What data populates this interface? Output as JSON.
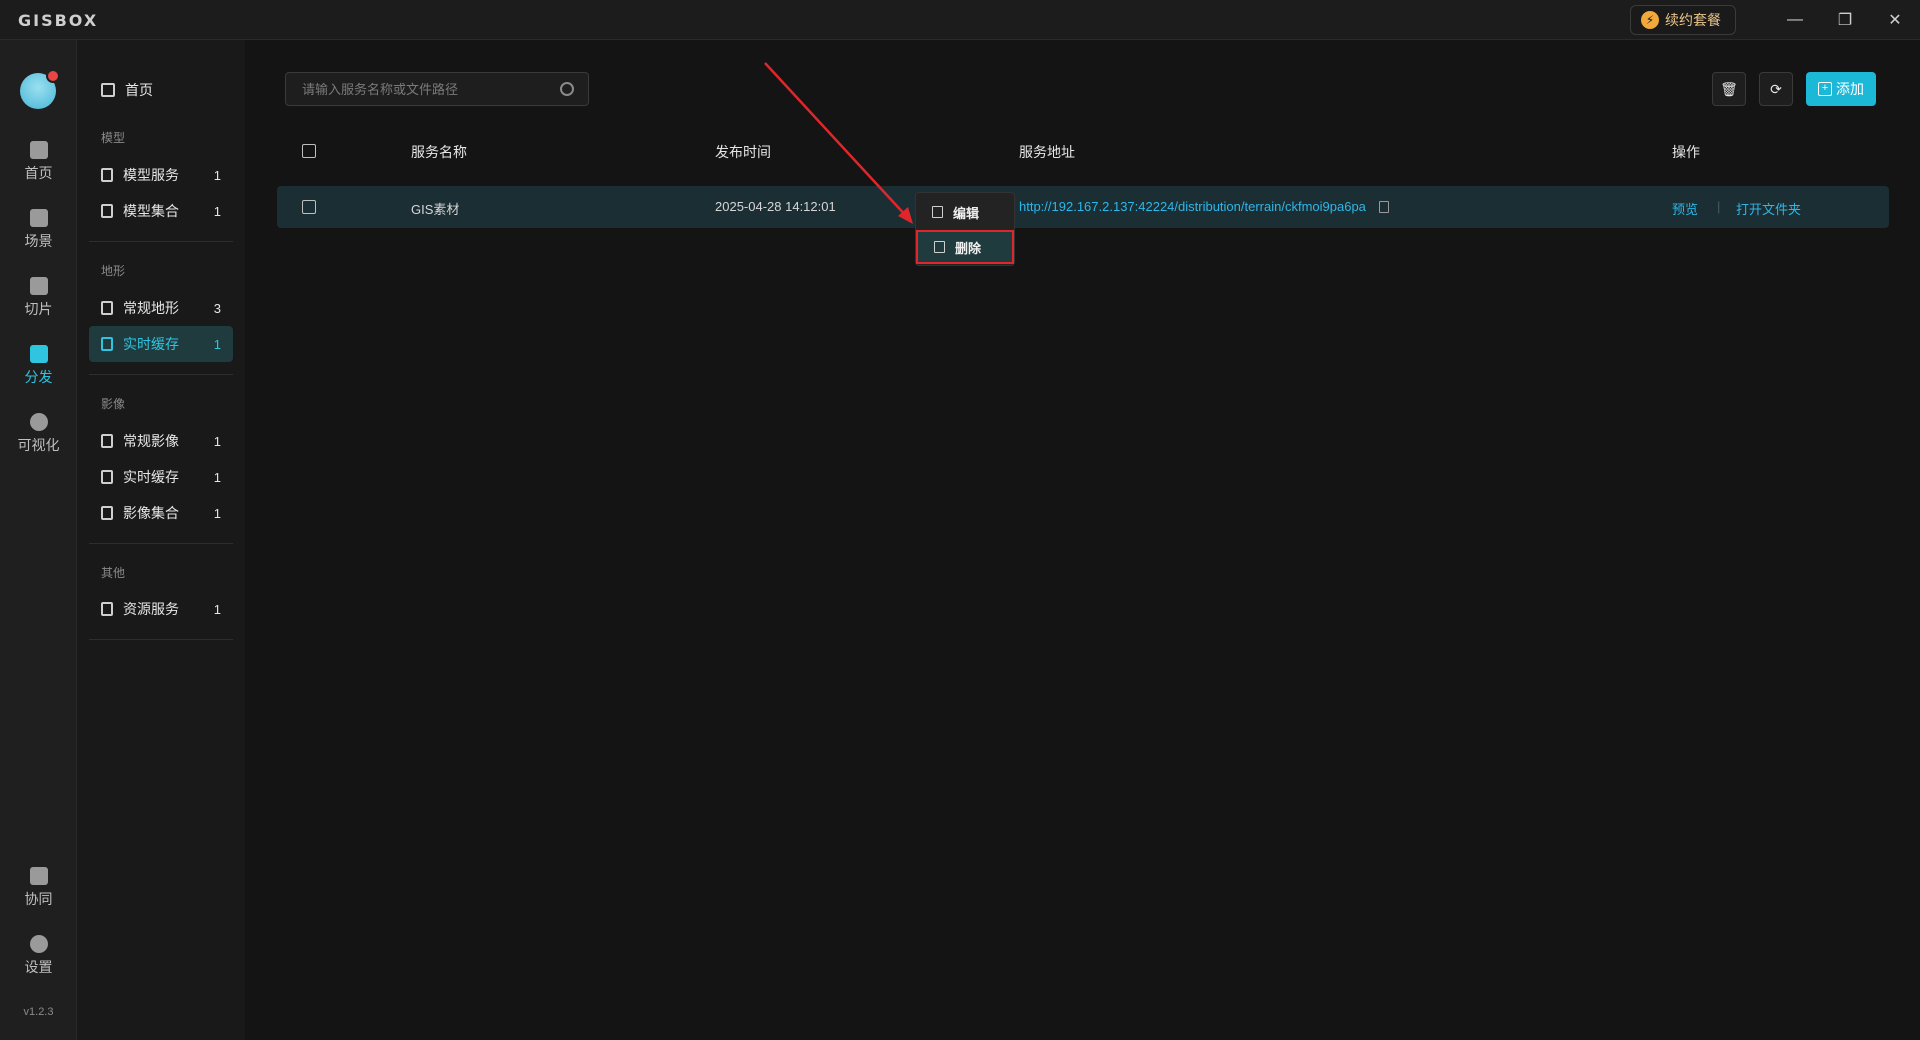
{
  "app": {
    "logo": "GISBOX",
    "renew_label": "续约套餐"
  },
  "window": {
    "minimize": "—",
    "restore": "❐",
    "close": "✕"
  },
  "rail": {
    "items": [
      {
        "label": "首页"
      },
      {
        "label": "场景"
      },
      {
        "label": "切片"
      },
      {
        "label": "分发"
      },
      {
        "label": "可视化"
      },
      {
        "label": "协同"
      },
      {
        "label": "设置"
      }
    ],
    "version": "v1.2.3"
  },
  "sidebar": {
    "home": "首页",
    "groups": [
      {
        "label": "模型",
        "items": [
          {
            "label": "模型服务",
            "count": "1"
          },
          {
            "label": "模型集合",
            "count": "1"
          }
        ]
      },
      {
        "label": "地形",
        "items": [
          {
            "label": "常规地形",
            "count": "3"
          },
          {
            "label": "实时缓存",
            "count": "1"
          }
        ]
      },
      {
        "label": "影像",
        "items": [
          {
            "label": "常规影像",
            "count": "1"
          },
          {
            "label": "实时缓存",
            "count": "1"
          },
          {
            "label": "影像集合",
            "count": "1"
          }
        ]
      },
      {
        "label": "其他",
        "items": [
          {
            "label": "资源服务",
            "count": "1"
          }
        ]
      }
    ]
  },
  "search": {
    "placeholder": "请输入服务名称或文件路径"
  },
  "toolbar": {
    "add_label": "添加"
  },
  "table": {
    "headers": {
      "name": "服务名称",
      "time": "发布时间",
      "url": "服务地址",
      "ops": "操作"
    },
    "rows": [
      {
        "name": "GIS素材",
        "time": "2025-04-28 14:12:01",
        "url": "http://192.167.2.137:42224/distribution/terrain/ckfmoi9pa6pa",
        "preview": "预览",
        "sep": "|",
        "open_folder": "打开文件夹"
      }
    ]
  },
  "context_menu": {
    "edit": "编辑",
    "delete": "删除"
  },
  "colors": {
    "accent": "#1cb8d8",
    "highlight_border": "#e0262b",
    "arrow": "#e0262b"
  }
}
